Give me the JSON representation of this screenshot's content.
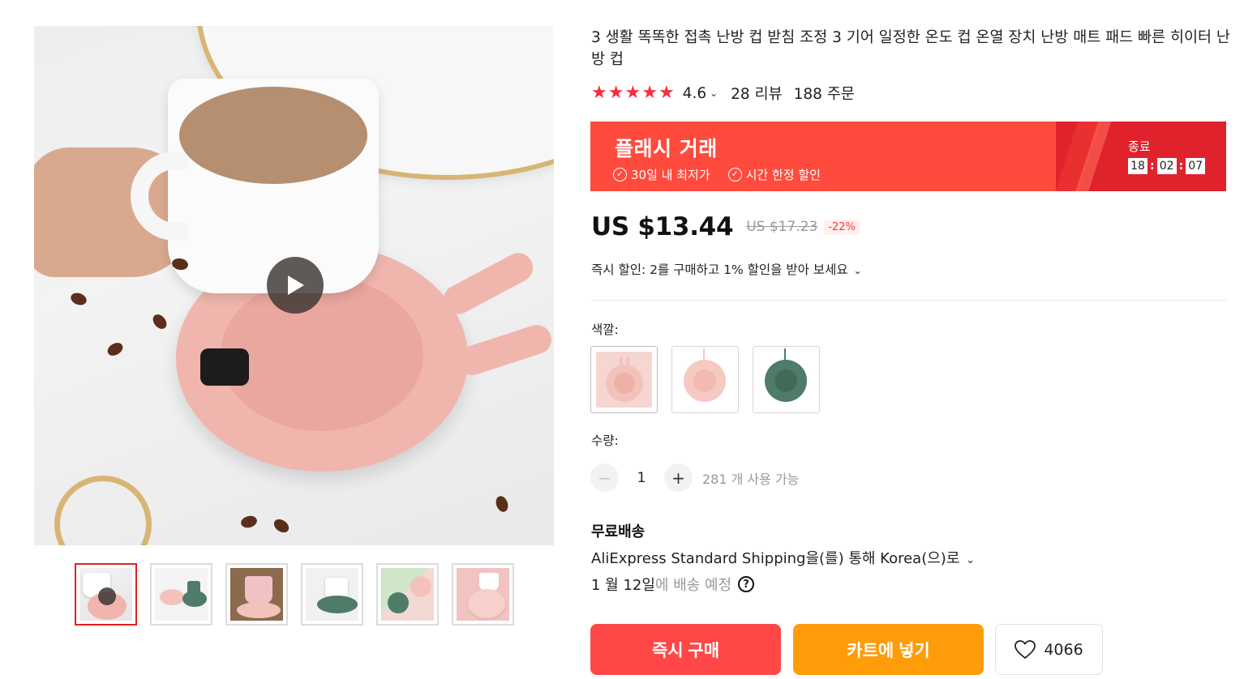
{
  "product": {
    "title": "3 생활 똑똑한 접촉 난방 컵 받침 조정 3 기어 일정한 온도 컵 온열 장치 난방 매트 패드 빠른 히이터 난방 컵",
    "rating": "4.6",
    "reviews": "28 리뷰",
    "orders": "188 주문",
    "stars": 5
  },
  "flash_deal": {
    "title": "플래시 거래",
    "badges": [
      "30일 내 최저가",
      "시간 한정 할인"
    ],
    "ends_label": "종료",
    "timer": {
      "hours": "18",
      "minutes": "02",
      "seconds": "07",
      "separator": ":"
    }
  },
  "price": {
    "current": "US $13.44",
    "original": "US $17.23",
    "discount": "-22%"
  },
  "instant_discount": "즉시 할인: 2를 구매하고 1% 할인을 받아 보세요",
  "color": {
    "label": "색깔:",
    "options": [
      {
        "name": "pink-bunny",
        "color": "#f3c3bb"
      },
      {
        "name": "pink",
        "color": "#f6c9c2"
      },
      {
        "name": "green",
        "color": "#4f7b69"
      }
    ]
  },
  "quantity": {
    "label": "수량:",
    "value": "1",
    "minus": "−",
    "plus": "+",
    "available": "281 개 사용 가능"
  },
  "shipping": {
    "title": "무료배송",
    "method": "AliExpress Standard Shipping을(를) 통해 Korea(으)로",
    "date": "1 월 12일",
    "date_suffix": "에 배송 예정",
    "help_icon": "?"
  },
  "actions": {
    "buy_now": "즉시 구매",
    "add_to_cart": "카트에 넣기",
    "wishlist_count": "4066"
  },
  "gallery": {
    "thumbnail_count": 6,
    "active_index": 0
  },
  "colors": {
    "accent": "#ff4747",
    "flash_bg": "#ff4b3e",
    "flash_dark": "#e0222c",
    "cart": "#ff9c09",
    "star": "#f3303b"
  }
}
